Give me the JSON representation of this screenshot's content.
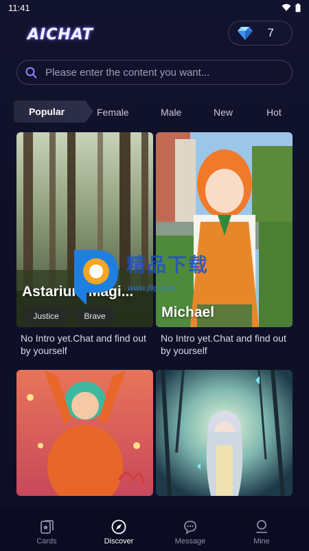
{
  "status_bar": {
    "time": "11:41"
  },
  "header": {
    "logo": "AICHAT",
    "gem_count": "7"
  },
  "search": {
    "placeholder": "Please enter the content you want..."
  },
  "tabs": [
    "Popular",
    "Female",
    "Male",
    "New",
    "Hot"
  ],
  "cards": [
    {
      "name": "Astarium Magi...",
      "tags": [
        "Justice",
        "Brave"
      ],
      "intro": "No Intro yet.Chat and find out by yourself"
    },
    {
      "name": "Michael",
      "tags": [],
      "intro": "No Intro yet.Chat and find out by yourself"
    },
    {
      "name": "",
      "tags": [],
      "intro": ""
    },
    {
      "name": "",
      "tags": [],
      "intro": ""
    }
  ],
  "watermark": {
    "text": "精品下载",
    "url": "www.j9p.com"
  },
  "bottom_nav": [
    {
      "label": "Cards",
      "icon": "cards-icon"
    },
    {
      "label": "Discover",
      "icon": "compass-icon"
    },
    {
      "label": "Message",
      "icon": "chat-icon"
    },
    {
      "label": "Mine",
      "icon": "person-icon"
    }
  ],
  "colors": {
    "background": "#0f1028",
    "accent": "#6f64ff",
    "nav_active": "#ffffff",
    "nav_inactive": "#8d8fa8"
  }
}
